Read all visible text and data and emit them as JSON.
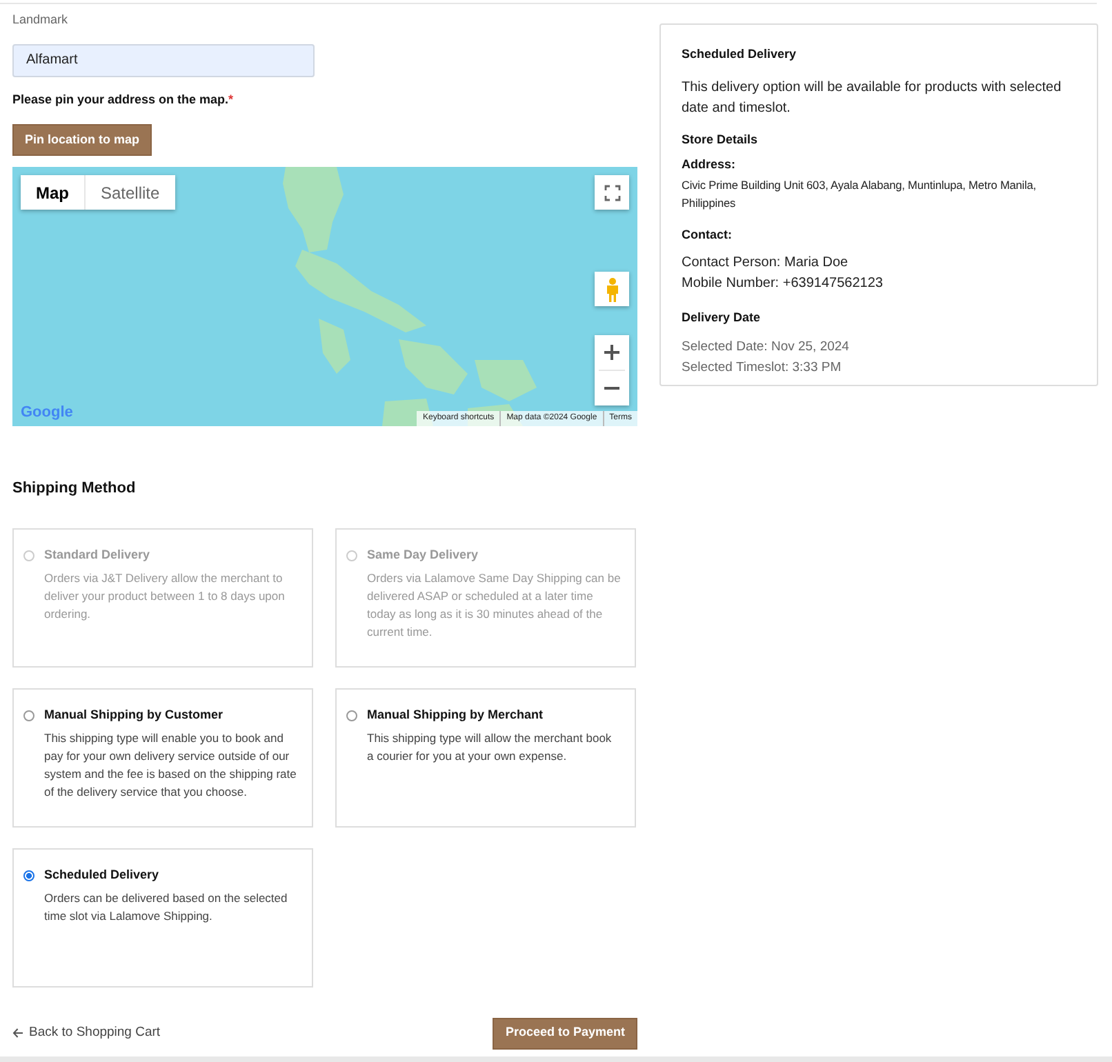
{
  "form": {
    "landmark": {
      "label": "Landmark",
      "value": "Alfamart"
    },
    "pin_prompt": {
      "text": "Please pin your address on the map.",
      "required_mark": "*"
    },
    "pin_button": "Pin location to map"
  },
  "map": {
    "map_types": [
      {
        "label": "Map",
        "selected": true
      },
      {
        "label": "Satellite",
        "selected": false
      }
    ],
    "logo": "Google",
    "attribution": [
      "Keyboard shortcuts",
      "Map data ©2024 Google",
      "Terms"
    ]
  },
  "shipping": {
    "title": "Shipping Method",
    "options": [
      {
        "title": "Standard Delivery",
        "description": "Orders via J&T Delivery allow the merchant to deliver your product between 1 to 8 days upon ordering.",
        "disabled": true,
        "selected": false
      },
      {
        "title": "Same Day Delivery",
        "description": "Orders via Lalamove Same Day Shipping can be delivered ASAP or scheduled at a later time today as long as it is 30 minutes ahead of the current time.",
        "disabled": true,
        "selected": false
      },
      {
        "title": "Manual Shipping by Customer",
        "description": "This shipping type will enable you to book and pay for your own delivery service outside of our system and the fee is based on the shipping rate of the delivery service that you choose.",
        "disabled": false,
        "selected": false
      },
      {
        "title": "Manual Shipping by Merchant",
        "description": "This shipping type will allow the merchant book a courier for you at your own expense.",
        "disabled": false,
        "selected": false
      },
      {
        "title": "Scheduled Delivery",
        "description": "Orders can be delivered based on the selected time slot via Lalamove Shipping.",
        "disabled": false,
        "selected": true
      }
    ]
  },
  "footer": {
    "back_link": "Back to Shopping Cart",
    "proceed_button": "Proceed to Payment"
  },
  "summary": {
    "title": "Scheduled Delivery",
    "description": "This delivery option will be available for products with selected date and timeslot.",
    "store_heading": "Store Details",
    "address_label": "Address:",
    "address": "Civic Prime Building Unit 603, Ayala Alabang, Muntinlupa, Metro Manila, Philippines",
    "contact_label": "Contact:",
    "contact_lines": [
      "Contact Person: Maria Doe",
      "Mobile Number: +639147562123"
    ],
    "date_heading": "Delivery Date",
    "date_lines": [
      "Selected Date: Nov 25, 2024",
      "Selected Timeslot: 3:33 PM"
    ]
  }
}
